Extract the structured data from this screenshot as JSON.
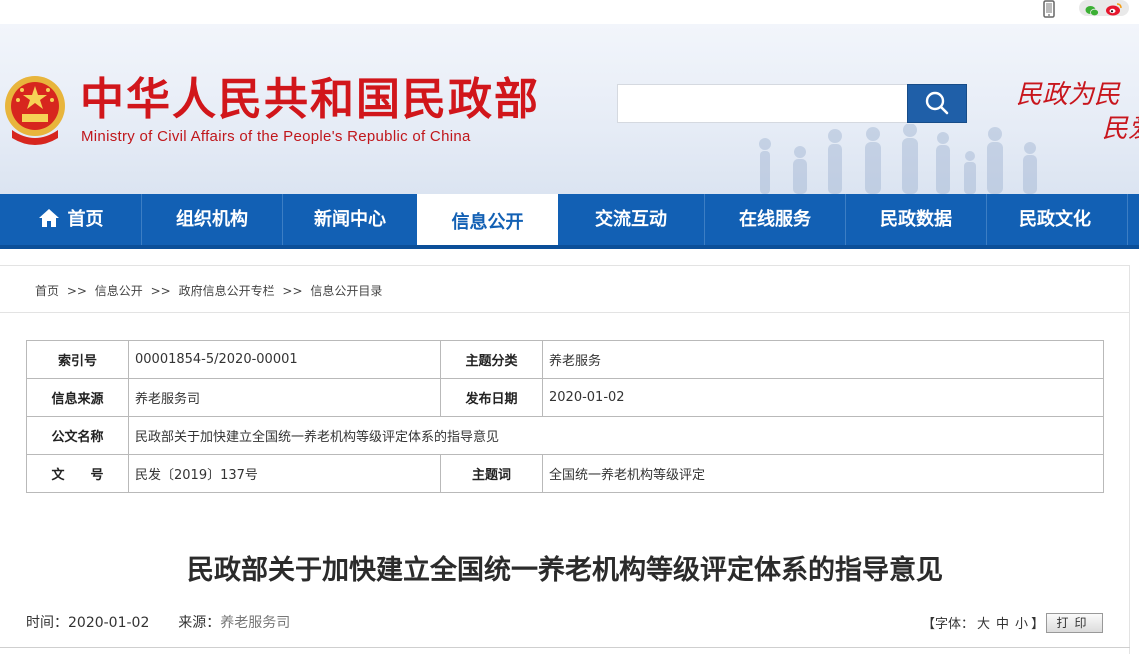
{
  "site": {
    "title_cn": "中华人民共和国民政部",
    "title_en": "Ministry of Civil Affairs of the People's Republic of China",
    "slogan_line1": "民政为民",
    "slogan_line2": "民爱",
    "search_placeholder": ""
  },
  "nav": {
    "items": [
      {
        "label": "首页"
      },
      {
        "label": "组织机构"
      },
      {
        "label": "新闻中心"
      },
      {
        "label": "信息公开"
      },
      {
        "label": "交流互动"
      },
      {
        "label": "在线服务"
      },
      {
        "label": "民政数据"
      },
      {
        "label": "民政文化"
      }
    ],
    "active": "信息公开"
  },
  "breadcrumb": {
    "items": [
      "首页",
      "信息公开",
      "政府信息公开专栏",
      "信息公开目录"
    ],
    "separator": ">>"
  },
  "meta": {
    "index_label": "索引号",
    "index_value": "00001854-5/2020-00001",
    "category_label": "主题分类",
    "category_value": "养老服务",
    "source_label": "信息来源",
    "source_value": "养老服务司",
    "date_label": "发布日期",
    "date_value": "2020-01-02",
    "name_label": "公文名称",
    "name_value": "民政部关于加快建立全国统一养老机构等级评定体系的指导意见",
    "docno_label": "文　　号",
    "docno_value": "民发〔2019〕137号",
    "keywords_label": "主题词",
    "keywords_value": "全国统一养老机构等级评定"
  },
  "article": {
    "title": "民政部关于加快建立全国统一养老机构等级评定体系的指导意见",
    "time_label": "时间：",
    "time_value": "2020-01-02",
    "source_label": "来源：",
    "source_value": "养老服务司",
    "font_label_open": "【字体：",
    "font_large": "大",
    "font_medium": "中",
    "font_small": "小",
    "font_label_close": "】",
    "print_label": "打印"
  },
  "colors": {
    "nav_bg": "#1260b4",
    "title_red": "#d1161b",
    "search_btn": "#1f5fa8"
  }
}
